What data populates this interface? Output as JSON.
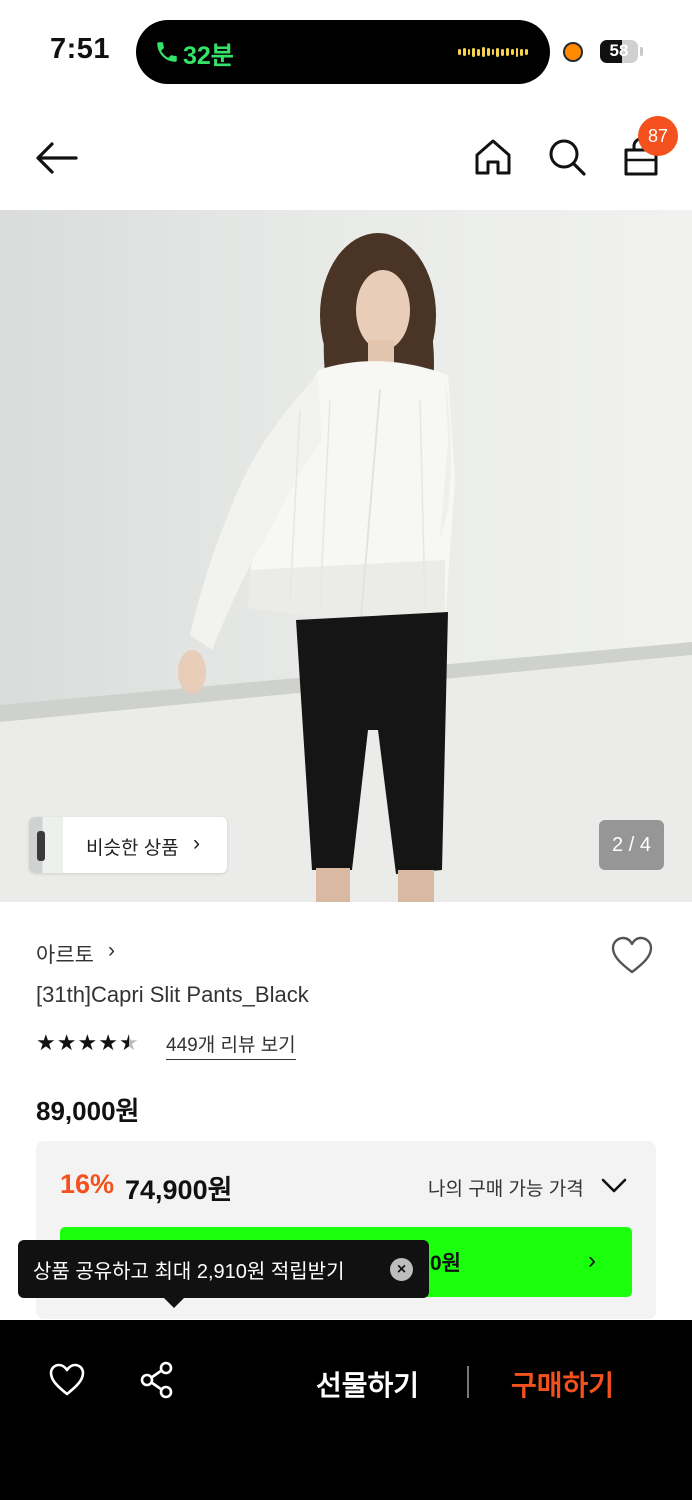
{
  "status_bar": {
    "time": "7:51",
    "call_duration": "32분",
    "battery_level": "58",
    "battery_fraction": 0.58
  },
  "nav": {
    "icons": [
      "back-arrow-icon",
      "home-icon",
      "search-icon",
      "shopping-bag-icon"
    ],
    "cart_count": "87",
    "badge_color": "#f4511e"
  },
  "gallery": {
    "similar_label": "비슷한 상품",
    "similar_chevron": "›",
    "pager": "2 / 4"
  },
  "product": {
    "brand": "아르토",
    "brand_chevron": "›",
    "name": "[31th]Capri Slit Pants_Black",
    "rating": 4.5,
    "review_link": "449개 리뷰 보기",
    "original_price": "89,000원"
  },
  "price_panel": {
    "discount_rate": "16%",
    "sale_price": "74,900원",
    "my_price_label": "나의 구매 가능 가격",
    "coupon_price_fragment": "0원",
    "coupon_chevron": "›",
    "coupon_button_color": "#19ff0c",
    "discount_color": "#f4511e"
  },
  "tooltip": {
    "text": "상품 공유하고 최대 2,910원 적립받기",
    "close": "×"
  },
  "bottom_bar": {
    "gift_label": "선물하기",
    "buy_label": "구매하기",
    "buy_color": "#f4511e"
  }
}
